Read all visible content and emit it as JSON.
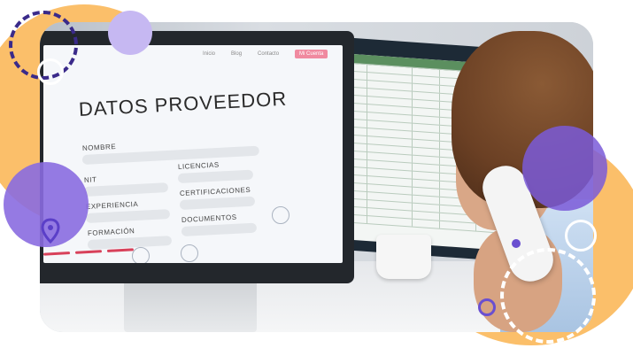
{
  "screen": {
    "nav": [
      "Inicio",
      "Blog",
      "Contacto",
      "Mi Cuenta"
    ],
    "form_title": "DATOS PROVEEDOR",
    "fields": {
      "nombre": "NOMBRE",
      "nit": "NIT",
      "experiencia": "EXPERIENCIA",
      "formacion": "FORMACIÓN",
      "licencias": "LICENCIAS",
      "certificaciones": "CERTIFICACIONES",
      "documentos": "DOCUMENTOS"
    }
  },
  "colors": {
    "orange": "#fbbf6a",
    "purple": "#8a6be0",
    "dark_purple": "#3a2a8a",
    "accent_red": "#d8415a"
  },
  "icons": [
    "location-pin-icon"
  ]
}
